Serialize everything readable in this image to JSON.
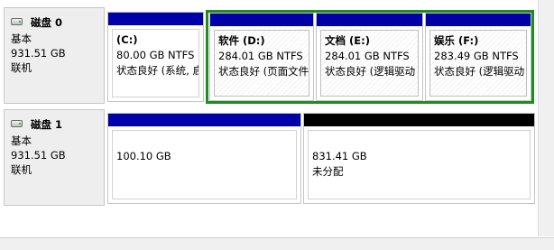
{
  "disks": [
    {
      "name": "磁盘 0",
      "type": "基本",
      "size": "931.51 GB",
      "status": "联机",
      "partitions": [
        {
          "label": "(C:)",
          "size_fs": "80.00 GB NTFS",
          "status": "状态良好 (系统, 启动"
        },
        {
          "label": "软件 (D:)",
          "size_fs": "284.01 GB NTFS",
          "status": "状态良好 (页面文件"
        },
        {
          "label": "文档 (E:)",
          "size_fs": "284.01 GB NTFS",
          "status": "状态良好 (逻辑驱动"
        },
        {
          "label": "娱乐 (F:)",
          "size_fs": "283.49 GB NTFS",
          "status": "状态良好 (逻辑驱动"
        }
      ]
    },
    {
      "name": "磁盘 1",
      "type": "基本",
      "size": "931.51 GB",
      "status": "联机",
      "partitions": [
        {
          "size": "100.10 GB"
        },
        {
          "size": "831.41 GB",
          "status": "未分配"
        }
      ]
    }
  ],
  "colors": {
    "primary_bar": "#0000a8",
    "unallocated_bar": "#000000",
    "extended_partition_frame": "#208b20"
  },
  "icons": {
    "disk": "hard-disk-icon"
  }
}
